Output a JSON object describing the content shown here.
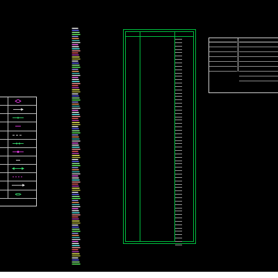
{
  "colors": {
    "background": "#000000",
    "table_border": "#00c040",
    "label_magenta": "#ff40ff",
    "text_grey": "#cfcfcf",
    "bottom_bar": "#ffffff"
  },
  "legend_left": {
    "symbols": [
      "diamond-icon",
      "arrow-right-icon",
      "line-dot-icon",
      "cable-short-icon",
      "dashed-line-icon",
      "fork-line-icon",
      "cross-line-icon",
      "short-line-icon",
      "arrow-double-icon",
      "dotted-line-icon",
      "long-arrow-icon",
      "swirl-icon"
    ]
  },
  "strip": {
    "colors": [
      "#ffffff",
      "#e0e0e0",
      "#ffff60",
      "#ffa060",
      "#ff6060",
      "#60ff60",
      "#60ffff",
      "#6060ff",
      "#ff60ff",
      "#c0c040",
      "#40c0c0",
      "#c040c0",
      "#a0a0ff",
      "#ffa0a0",
      "#a0ffa0",
      "#ffffff"
    ]
  },
  "main_table": {
    "headers": [
      "",
      "",
      ""
    ],
    "rows": [
      {
        "c1": "",
        "c2": "",
        "c3": ""
      }
    ]
  },
  "right_tables": {
    "left_title": "",
    "right_title": "",
    "left_rows": 6,
    "right_rows": 8
  }
}
